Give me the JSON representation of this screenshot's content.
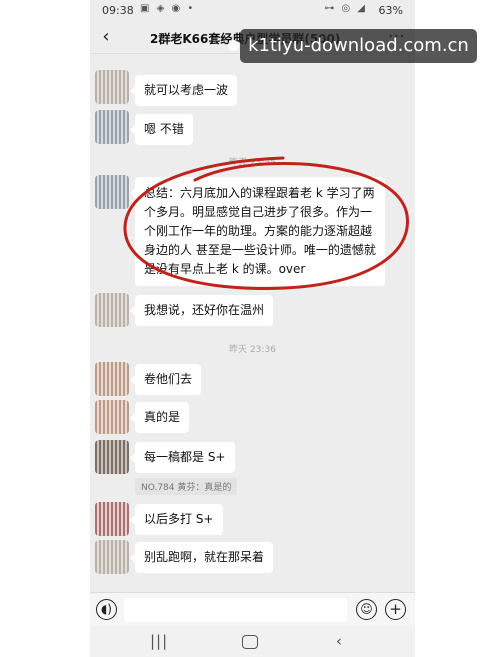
{
  "status_bar": {
    "time": "09:38",
    "left_icons": "▣ ◈ ◉ •",
    "right_icons": "⊶ ◎ ◢",
    "battery": "63%"
  },
  "header": {
    "back_symbol": "‹",
    "title": "2群老K66套经典户型学员群(500)",
    "more_symbol": "···"
  },
  "watermark": {
    "text": "k1tiyu-download.com.cn"
  },
  "messages": [
    {
      "text": "就可以考虑一波"
    },
    {
      "text": "嗯  不错"
    },
    {
      "time": "昨天 23:35"
    },
    {
      "text": "总结：六月底加入的课程跟着老 k 学习了两个多月。明显感觉自己进步了很多。作为一个刚工作一年的助理。方案的能力逐渐超越身边的人 甚至是一些设计师。唯一的遗憾就是没有早点上老 k 的课。over"
    },
    {
      "text": "我想说，还好你在温州"
    },
    {
      "time": "昨天 23:36"
    },
    {
      "text": "卷他们去"
    },
    {
      "text": "真的是"
    },
    {
      "text": "每一稿都是 S+"
    },
    {
      "quote": "NO.784  黄芬：真是的"
    },
    {
      "text": "以后多打 S+"
    },
    {
      "text": "别乱跑啊，就在那呆着"
    }
  ],
  "input_bar": {
    "voice_symbol": "◖)",
    "emoji_symbol": "☺",
    "plus_symbol": "+"
  },
  "nav_bar": {
    "recent_symbol": "|||",
    "back_symbol": "‹"
  },
  "colors": {
    "chat_background": "#ededed",
    "bubble": "#ffffff",
    "annotation_red": "#c0221c"
  },
  "icons": [
    "back-icon",
    "more-icon",
    "voice-icon",
    "emoji-icon",
    "plus-icon",
    "nav-recent-icon",
    "nav-home-icon",
    "nav-back-icon"
  ]
}
